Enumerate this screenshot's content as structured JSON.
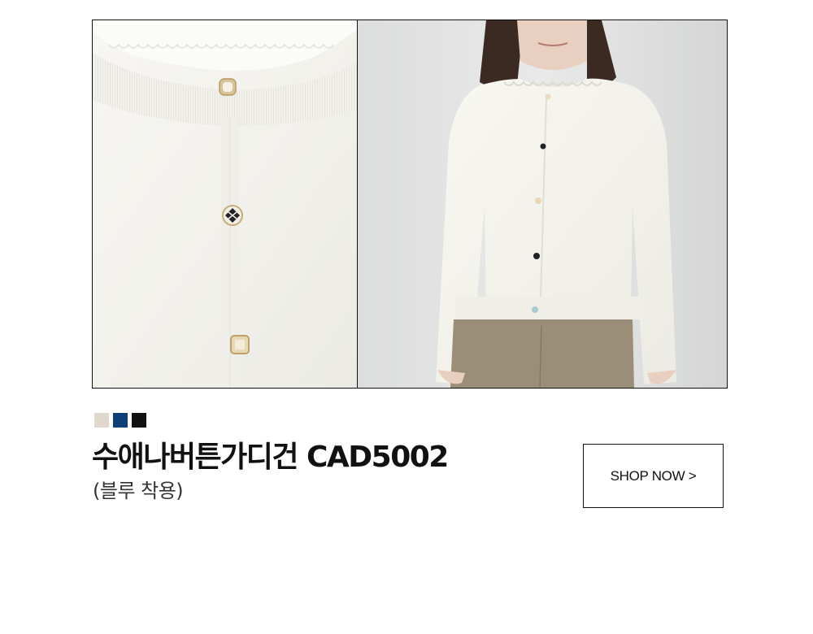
{
  "product": {
    "name": "수애나버튼가디건 CAD5002",
    "subtitle": "(블루 착용)",
    "swatches": [
      {
        "name": "beige",
        "color": "#e0d8cc"
      },
      {
        "name": "navy",
        "color": "#0e3f78"
      },
      {
        "name": "black",
        "color": "#111111"
      }
    ]
  },
  "cta": {
    "label": "SHOP NOW >"
  },
  "images": {
    "left": "close-up-cardigan-buttons",
    "right": "model-wearing-cardigan"
  }
}
